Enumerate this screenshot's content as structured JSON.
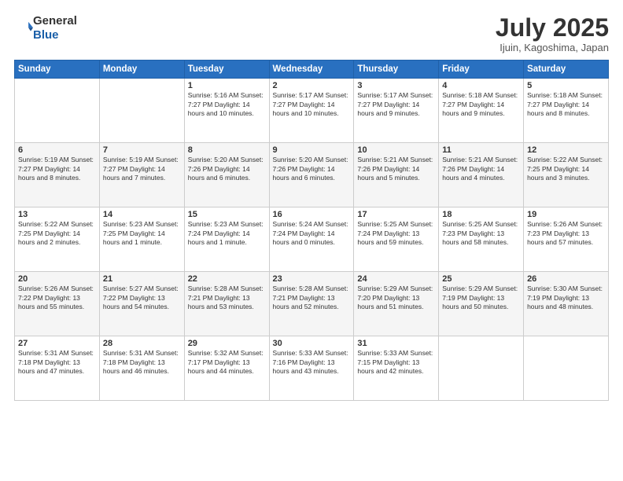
{
  "header": {
    "logo_line1": "General",
    "logo_line2": "Blue",
    "month_title": "July 2025",
    "location": "Ijuin, Kagoshima, Japan"
  },
  "weekdays": [
    "Sunday",
    "Monday",
    "Tuesday",
    "Wednesday",
    "Thursday",
    "Friday",
    "Saturday"
  ],
  "weeks": [
    [
      {
        "day": "",
        "info": ""
      },
      {
        "day": "",
        "info": ""
      },
      {
        "day": "1",
        "info": "Sunrise: 5:16 AM\nSunset: 7:27 PM\nDaylight: 14 hours and 10 minutes."
      },
      {
        "day": "2",
        "info": "Sunrise: 5:17 AM\nSunset: 7:27 PM\nDaylight: 14 hours and 10 minutes."
      },
      {
        "day": "3",
        "info": "Sunrise: 5:17 AM\nSunset: 7:27 PM\nDaylight: 14 hours and 9 minutes."
      },
      {
        "day": "4",
        "info": "Sunrise: 5:18 AM\nSunset: 7:27 PM\nDaylight: 14 hours and 9 minutes."
      },
      {
        "day": "5",
        "info": "Sunrise: 5:18 AM\nSunset: 7:27 PM\nDaylight: 14 hours and 8 minutes."
      }
    ],
    [
      {
        "day": "6",
        "info": "Sunrise: 5:19 AM\nSunset: 7:27 PM\nDaylight: 14 hours and 8 minutes."
      },
      {
        "day": "7",
        "info": "Sunrise: 5:19 AM\nSunset: 7:27 PM\nDaylight: 14 hours and 7 minutes."
      },
      {
        "day": "8",
        "info": "Sunrise: 5:20 AM\nSunset: 7:26 PM\nDaylight: 14 hours and 6 minutes."
      },
      {
        "day": "9",
        "info": "Sunrise: 5:20 AM\nSunset: 7:26 PM\nDaylight: 14 hours and 6 minutes."
      },
      {
        "day": "10",
        "info": "Sunrise: 5:21 AM\nSunset: 7:26 PM\nDaylight: 14 hours and 5 minutes."
      },
      {
        "day": "11",
        "info": "Sunrise: 5:21 AM\nSunset: 7:26 PM\nDaylight: 14 hours and 4 minutes."
      },
      {
        "day": "12",
        "info": "Sunrise: 5:22 AM\nSunset: 7:25 PM\nDaylight: 14 hours and 3 minutes."
      }
    ],
    [
      {
        "day": "13",
        "info": "Sunrise: 5:22 AM\nSunset: 7:25 PM\nDaylight: 14 hours and 2 minutes."
      },
      {
        "day": "14",
        "info": "Sunrise: 5:23 AM\nSunset: 7:25 PM\nDaylight: 14 hours and 1 minute."
      },
      {
        "day": "15",
        "info": "Sunrise: 5:23 AM\nSunset: 7:24 PM\nDaylight: 14 hours and 1 minute."
      },
      {
        "day": "16",
        "info": "Sunrise: 5:24 AM\nSunset: 7:24 PM\nDaylight: 14 hours and 0 minutes."
      },
      {
        "day": "17",
        "info": "Sunrise: 5:25 AM\nSunset: 7:24 PM\nDaylight: 13 hours and 59 minutes."
      },
      {
        "day": "18",
        "info": "Sunrise: 5:25 AM\nSunset: 7:23 PM\nDaylight: 13 hours and 58 minutes."
      },
      {
        "day": "19",
        "info": "Sunrise: 5:26 AM\nSunset: 7:23 PM\nDaylight: 13 hours and 57 minutes."
      }
    ],
    [
      {
        "day": "20",
        "info": "Sunrise: 5:26 AM\nSunset: 7:22 PM\nDaylight: 13 hours and 55 minutes."
      },
      {
        "day": "21",
        "info": "Sunrise: 5:27 AM\nSunset: 7:22 PM\nDaylight: 13 hours and 54 minutes."
      },
      {
        "day": "22",
        "info": "Sunrise: 5:28 AM\nSunset: 7:21 PM\nDaylight: 13 hours and 53 minutes."
      },
      {
        "day": "23",
        "info": "Sunrise: 5:28 AM\nSunset: 7:21 PM\nDaylight: 13 hours and 52 minutes."
      },
      {
        "day": "24",
        "info": "Sunrise: 5:29 AM\nSunset: 7:20 PM\nDaylight: 13 hours and 51 minutes."
      },
      {
        "day": "25",
        "info": "Sunrise: 5:29 AM\nSunset: 7:19 PM\nDaylight: 13 hours and 50 minutes."
      },
      {
        "day": "26",
        "info": "Sunrise: 5:30 AM\nSunset: 7:19 PM\nDaylight: 13 hours and 48 minutes."
      }
    ],
    [
      {
        "day": "27",
        "info": "Sunrise: 5:31 AM\nSunset: 7:18 PM\nDaylight: 13 hours and 47 minutes."
      },
      {
        "day": "28",
        "info": "Sunrise: 5:31 AM\nSunset: 7:18 PM\nDaylight: 13 hours and 46 minutes."
      },
      {
        "day": "29",
        "info": "Sunrise: 5:32 AM\nSunset: 7:17 PM\nDaylight: 13 hours and 44 minutes."
      },
      {
        "day": "30",
        "info": "Sunrise: 5:33 AM\nSunset: 7:16 PM\nDaylight: 13 hours and 43 minutes."
      },
      {
        "day": "31",
        "info": "Sunrise: 5:33 AM\nSunset: 7:15 PM\nDaylight: 13 hours and 42 minutes."
      },
      {
        "day": "",
        "info": ""
      },
      {
        "day": "",
        "info": ""
      }
    ]
  ]
}
